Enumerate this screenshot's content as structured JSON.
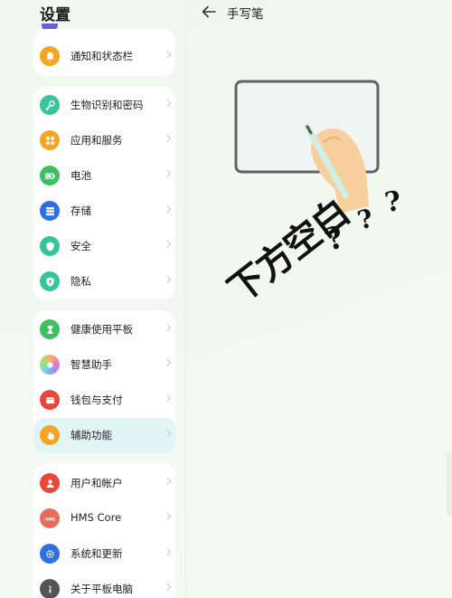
{
  "settings": {
    "title": "设置",
    "items": [
      {
        "label": "通知和状态栏",
        "icon": "bell-icon",
        "color": "#f5a524"
      },
      {
        "label": "生物识别和密码",
        "icon": "key-icon",
        "color": "#37c49b"
      },
      {
        "label": "应用和服务",
        "icon": "apps-grid-icon",
        "color": "#f5a524"
      },
      {
        "label": "电池",
        "icon": "battery-icon",
        "color": "#3fc060"
      },
      {
        "label": "存储",
        "icon": "storage-icon",
        "color": "#2f6fe0"
      },
      {
        "label": "安全",
        "icon": "shield-icon",
        "color": "#37c49b"
      },
      {
        "label": "隐私",
        "icon": "privacy-shield-icon",
        "color": "#37c49b"
      },
      {
        "label": "健康使用平板",
        "icon": "hourglass-icon",
        "color": "#3fc060"
      },
      {
        "label": "智慧助手",
        "icon": "assistant-icon",
        "color": "#b48ef0"
      },
      {
        "label": "钱包与支付",
        "icon": "wallet-icon",
        "color": "#e8473a"
      },
      {
        "label": "辅助功能",
        "icon": "hand-icon",
        "color": "#f5a524"
      },
      {
        "label": "用户和帐户",
        "icon": "user-icon",
        "color": "#e8473a"
      },
      {
        "label": "HMS Core",
        "icon": "hms-icon",
        "color": "#e86a5a"
      },
      {
        "label": "系统和更新",
        "icon": "gear-icon",
        "color": "#2f6fe0"
      },
      {
        "label": "关于平板电脑",
        "icon": "info-icon",
        "color": "#555555"
      }
    ]
  },
  "detail": {
    "title": "手写笔"
  },
  "overlay": {
    "text": "下方空白",
    "q1": "?",
    "q2": "?",
    "q3": "?"
  }
}
